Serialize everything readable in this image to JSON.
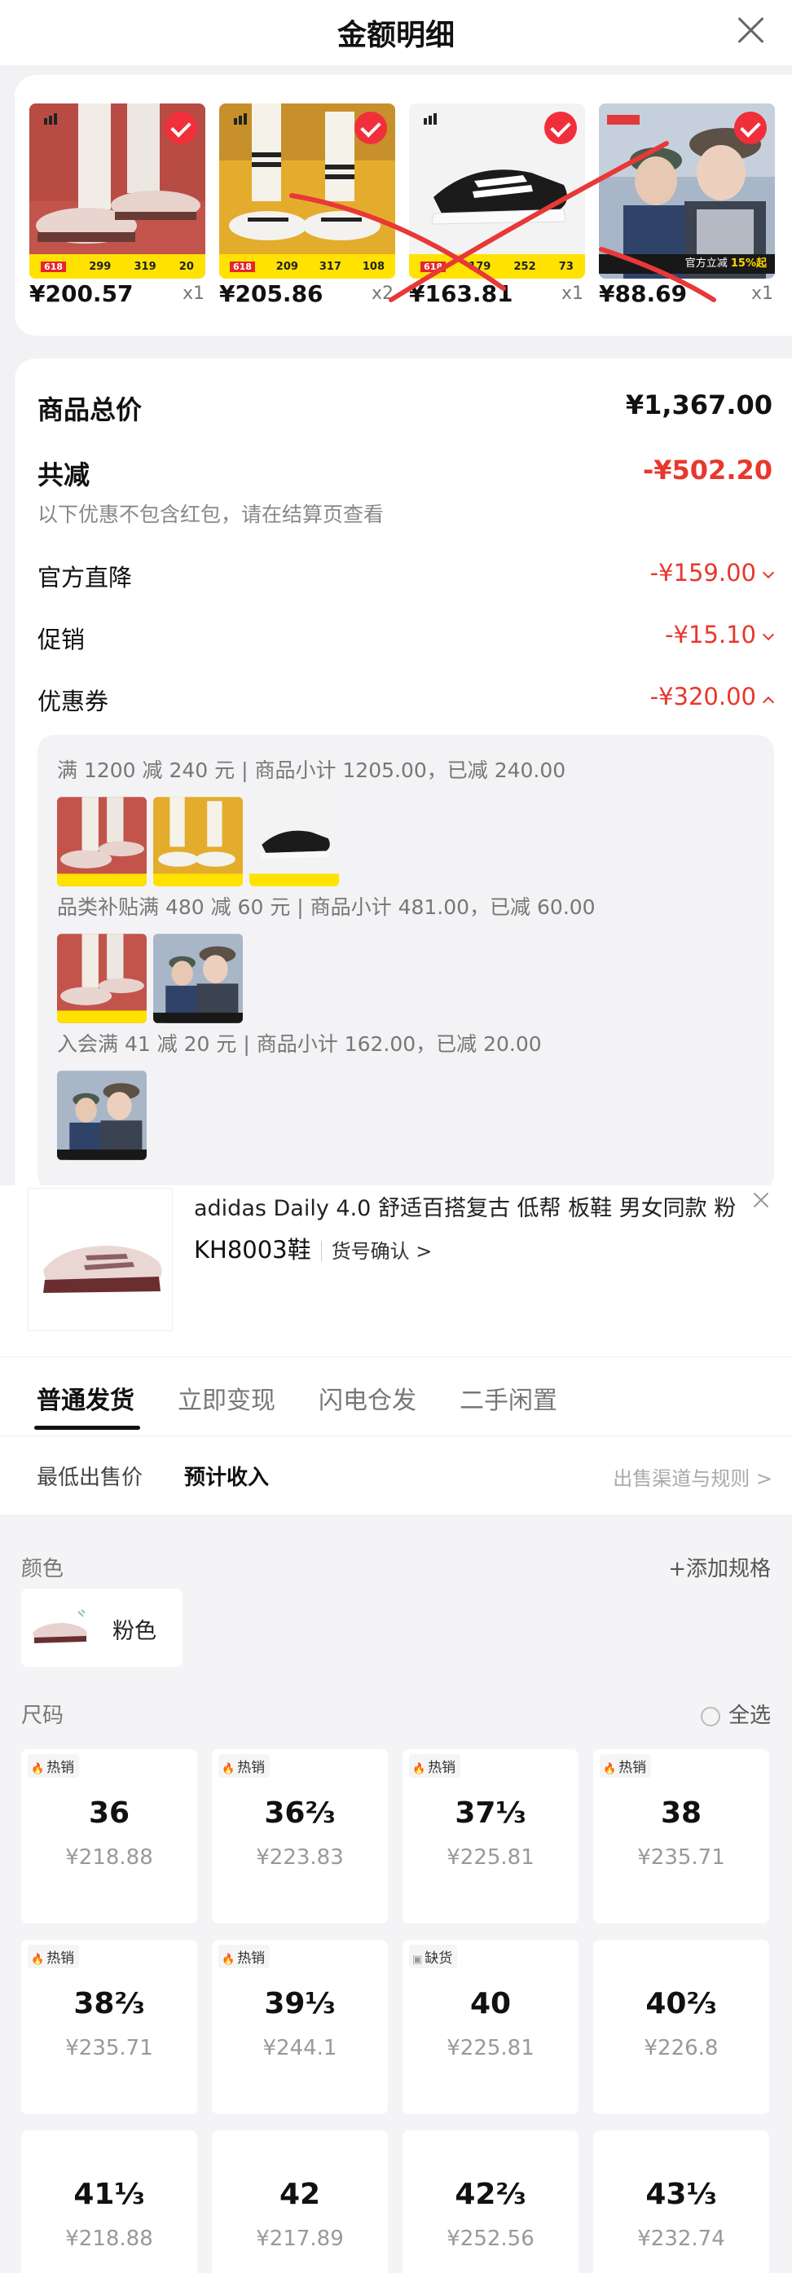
{
  "sheet": {
    "title": "金额明细",
    "products": [
      {
        "price": "¥200.57",
        "qty": "x1",
        "promo": [
          "299",
          "319",
          "20"
        ],
        "tag": "618"
      },
      {
        "price": "¥205.86",
        "qty": "x2",
        "promo": [
          "209",
          "317",
          "108"
        ],
        "tag": "618"
      },
      {
        "price": "¥163.81",
        "qty": "x1",
        "promo": [
          "179",
          "252",
          "73"
        ],
        "tag": "618"
      },
      {
        "price": "¥88.69",
        "qty": "x1",
        "promo_text": "官方立减",
        "promo_pct": "15%起"
      }
    ],
    "summary": {
      "total_label": "商品总价",
      "total_value": "¥1,367.00",
      "discount_label": "共减",
      "discount_value": "-¥502.20",
      "note": "以下优惠不包含红包，请在结算页查看",
      "items": [
        {
          "label": "官方直降",
          "value": "-¥159.00"
        },
        {
          "label": "促销",
          "value": "-¥15.10"
        },
        {
          "label": "优惠券",
          "value": "-¥320.00"
        }
      ]
    },
    "coupons": [
      "满 1200 减 240 元 | 商品小计 1205.00，已减 240.00",
      "品类补贴满 480 减 60 元 | 商品小计 481.00，已减 60.00",
      "入会满 41 减 20 元 | 商品小计 162.00，已减 20.00"
    ]
  },
  "selector": {
    "product_name": "adidas Daily 4.0 舒适百搭复古 低帮 板鞋 男女同款 粉",
    "product_code": "KH8003鞋",
    "code_confirm": "货号确认 >",
    "tabs": [
      "普通发货",
      "立即变现",
      "闪电仓发",
      "二手闲置"
    ],
    "subtabs": [
      "最低出售价",
      "预计收入"
    ],
    "rules_link": "出售渠道与规则 >",
    "color_label": "颜色",
    "add_spec": "+添加规格",
    "color_value": "粉色",
    "size_label": "尺码",
    "select_all": "全选",
    "sizes": [
      {
        "tag": "热销",
        "size": "36",
        "price": "¥218.88"
      },
      {
        "tag": "热销",
        "size": "36⅔",
        "price": "¥223.83"
      },
      {
        "tag": "热销",
        "size": "37⅓",
        "price": "¥225.81"
      },
      {
        "tag": "热销",
        "size": "38",
        "price": "¥235.71"
      },
      {
        "tag": "热销",
        "size": "38⅔",
        "price": "¥235.71"
      },
      {
        "tag": "热销",
        "size": "39⅓",
        "price": "¥244.1"
      },
      {
        "tag": "缺货",
        "size": "40",
        "price": "¥225.81"
      },
      {
        "tag": "",
        "size": "40⅔",
        "price": "¥226.8"
      },
      {
        "tag": "",
        "size": "41⅓",
        "price": "¥218.88"
      },
      {
        "tag": "",
        "size": "42",
        "price": "¥217.89"
      },
      {
        "tag": "",
        "size": "42⅔",
        "price": "¥252.56"
      },
      {
        "tag": "",
        "size": "43⅓",
        "price": "¥232.74"
      }
    ]
  }
}
